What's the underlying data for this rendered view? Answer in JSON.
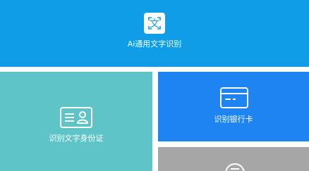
{
  "tiles": {
    "general_text": {
      "label": "Ai通用文字识别",
      "icon": "text-scan-icon",
      "icon_glyph": "文",
      "color": "#0e9de6"
    },
    "id_card": {
      "label": "识别文字身份证",
      "icon": "id-card-icon",
      "color": "#5ec4c8"
    },
    "bank_card": {
      "label": "识别银行卡",
      "icon": "bank-card-icon",
      "color": "#1d84f1"
    },
    "more": {
      "label": "",
      "icon": "round-icon",
      "color": "#a6a6a6"
    }
  }
}
